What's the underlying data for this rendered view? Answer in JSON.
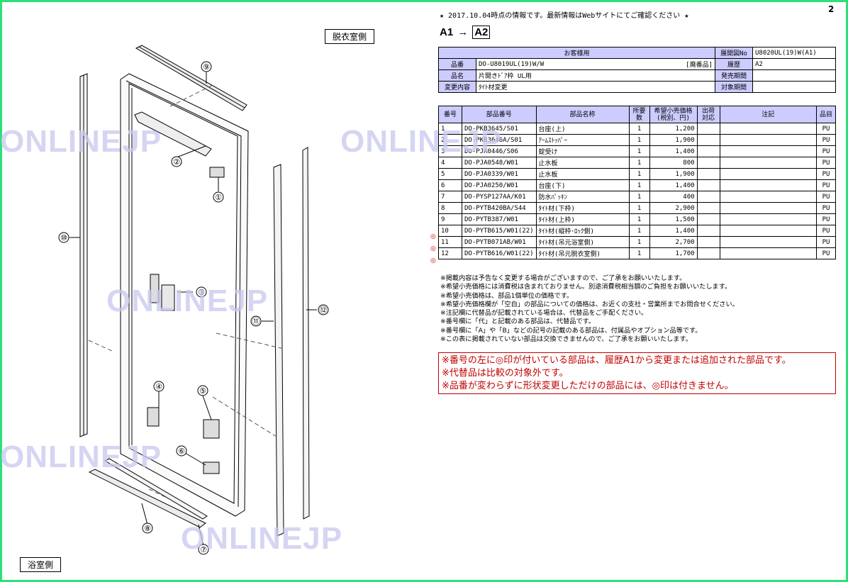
{
  "page_number": "2",
  "notice": "★ 2017.10.04時点の情報です。最新情報はWebサイトにてご確認ください ★",
  "revision": {
    "from": "A1",
    "to": "A2"
  },
  "labels": {
    "dressing_side": "脱衣室側",
    "bathroom_side": "浴室側"
  },
  "watermark": "ONLINEJP",
  "info_table": {
    "customer_header": "お客様用",
    "rows": [
      {
        "label": "品番",
        "value": "DO-U8019UL(19)W/W",
        "extra": "[廃番品]",
        "label2": "履歴",
        "value2": "A2"
      },
      {
        "label": "品名",
        "value": "片開きﾄﾞｱ枠 UL用",
        "extra": "",
        "label2": "発売期間",
        "value2": ""
      },
      {
        "label": "変更内容",
        "value": "ﾀｲﾄ材変更",
        "extra": "",
        "label2": "対象期間",
        "value2": ""
      }
    ],
    "exploded_label": "展開図No",
    "exploded_value": "U8020UL(19)W(A1)"
  },
  "parts_table": {
    "headers": [
      "番号",
      "部品番号",
      "部品名称",
      "所要数",
      "希望小売価格(税別、円)",
      "出荷対応",
      "注記",
      "品目"
    ],
    "header_lines": {
      "qty": [
        "所要",
        "数"
      ],
      "price": [
        "希望小売価格",
        "(税別、円)"
      ],
      "ship": [
        "出荷",
        "対応"
      ]
    },
    "rows": [
      {
        "no": "1",
        "part": "DO-PKB3645/S01",
        "name": "台座(上)",
        "qty": "1",
        "price": "1,200",
        "ship": "",
        "note": "",
        "item": "PU",
        "mark": ""
      },
      {
        "no": "2",
        "part": "DO-PKB3646A/S01",
        "name": "ｱｰﾑｽﾄｯﾊﾟｰ",
        "qty": "1",
        "price": "1,900",
        "ship": "",
        "note": "",
        "item": "PU",
        "mark": ""
      },
      {
        "no": "3",
        "part": "DO-PJA0446/S06",
        "name": "錠受け",
        "qty": "1",
        "price": "1,400",
        "ship": "",
        "note": "",
        "item": "PU",
        "mark": ""
      },
      {
        "no": "4",
        "part": "DO-PJA0548/W01",
        "name": "止水板",
        "qty": "1",
        "price": "800",
        "ship": "",
        "note": "",
        "item": "PU",
        "mark": ""
      },
      {
        "no": "5",
        "part": "DO-PJA0339/W01",
        "name": "止水板",
        "qty": "1",
        "price": "1,900",
        "ship": "",
        "note": "",
        "item": "PU",
        "mark": ""
      },
      {
        "no": "6",
        "part": "DO-PJA0250/W01",
        "name": "台座(下)",
        "qty": "1",
        "price": "1,400",
        "ship": "",
        "note": "",
        "item": "PU",
        "mark": ""
      },
      {
        "no": "7",
        "part": "DO-PYSP127AA/K01",
        "name": "防水ﾊﾟｯｷﾝ",
        "qty": "1",
        "price": "400",
        "ship": "",
        "note": "",
        "item": "PU",
        "mark": ""
      },
      {
        "no": "8",
        "part": "DO-PYTB420BA/S44",
        "name": "ﾀｲﾄ材(下枠)",
        "qty": "1",
        "price": "2,900",
        "ship": "",
        "note": "",
        "item": "PU",
        "mark": ""
      },
      {
        "no": "9",
        "part": "DO-PYTB387/W01",
        "name": "ﾀｲﾄ材(上枠)",
        "qty": "1",
        "price": "1,500",
        "ship": "",
        "note": "",
        "item": "PU",
        "mark": ""
      },
      {
        "no": "10",
        "part": "DO-PYTB615/W01(22)",
        "name": "ﾀｲﾄ材(縦枠･ﾛｯｸ側)",
        "qty": "1",
        "price": "1,400",
        "ship": "",
        "note": "",
        "item": "PU",
        "mark": "◎"
      },
      {
        "no": "11",
        "part": "DO-PYTB071AB/W01",
        "name": "ﾀｲﾄ材(吊元浴室側)",
        "qty": "1",
        "price": "2,700",
        "ship": "",
        "note": "",
        "item": "PU",
        "mark": "◎"
      },
      {
        "no": "12",
        "part": "DO-PYTB616/W01(22)",
        "name": "ﾀｲﾄ材(吊元脱衣室側)",
        "qty": "1",
        "price": "1,700",
        "ship": "",
        "note": "",
        "item": "PU",
        "mark": "◎"
      }
    ]
  },
  "notes": [
    "※掲載内容は予告なく変更する場合がございますので、ご了承をお願いいたします。",
    "※希望小売価格には消費税は含まれておりません。別途消費税相当額のご負担をお願いいたします。",
    "※希望小売価格は、部品1個単位の価格です。",
    "※希望小売価格欄が「空白」の部品についての価格は、お近くの支社・営業所までお問合せください。",
    "※注記欄に代替品が記載されている場合は、代替品をご手配ください。",
    "※番号欄に「代」と記載のある部品は、代替品です。",
    "※番号欄に「A」や「B」などの記号の記載のある部品は、付属品やオプション品等です。",
    "※この表に掲載されていない部品は交換できませんので、ご了承をお願いいたします。"
  ],
  "red_notes": [
    "※番号の左に◎印が付いている部品は、履歴A1から変更または追加された部品です。",
    "※代替品は比較の対象外です。",
    "※品番が変わらずに形状変更しただけの部品には、◎印は付きません。"
  ],
  "callouts": [
    "①",
    "②",
    "③",
    "④",
    "⑤",
    "⑥",
    "⑦",
    "⑧",
    "⑨",
    "⑩",
    "⑪",
    "⑫"
  ]
}
